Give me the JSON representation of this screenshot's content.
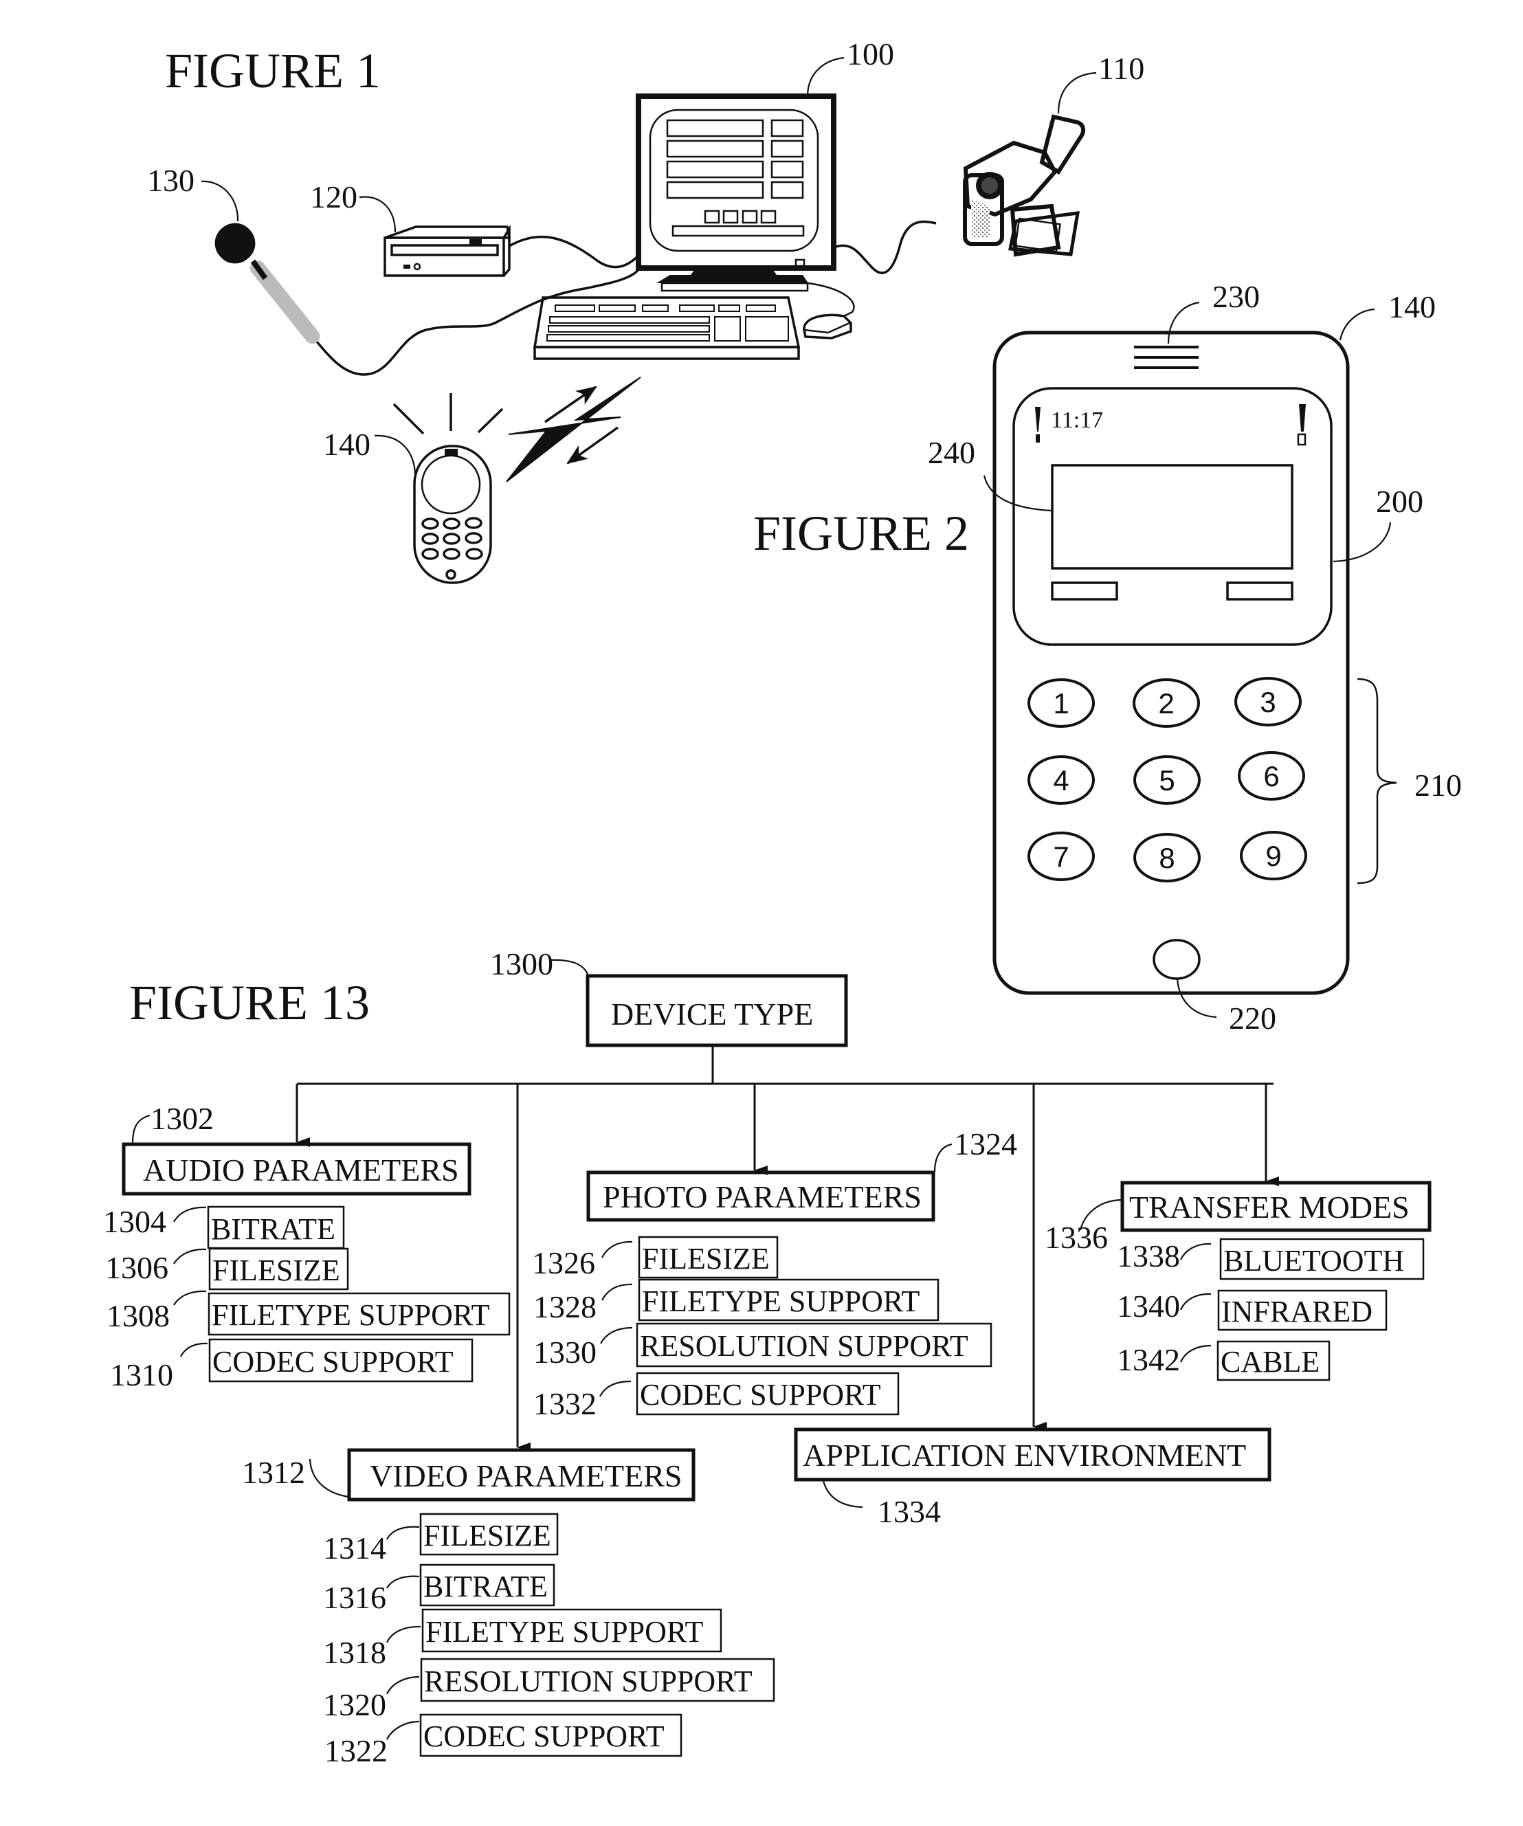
{
  "figures": {
    "fig1": {
      "title": "FIGURE 1",
      "refs": {
        "computer": "100",
        "camcorder": "110",
        "disc_drive": "120",
        "microphone": "130",
        "mobile_phone": "140"
      }
    },
    "fig2": {
      "title": "FIGURE 2",
      "refs": {
        "phone": "140",
        "display_area": "200",
        "keypad": "210",
        "home_button": "220",
        "speaker": "230",
        "screen": "240"
      },
      "status_text": "11:17",
      "keys": [
        "1",
        "2",
        "3",
        "4",
        "5",
        "6",
        "7",
        "8",
        "9"
      ]
    },
    "fig13": {
      "title": "FIGURE 13",
      "root": {
        "ref": "1300",
        "label": "DEVICE TYPE"
      },
      "audio": {
        "ref": "1302",
        "label": "AUDIO PARAMETERS",
        "items": [
          {
            "ref": "1304",
            "label": "BITRATE"
          },
          {
            "ref": "1306",
            "label": "FILESIZE"
          },
          {
            "ref": "1308",
            "label": "FILETYPE SUPPORT"
          },
          {
            "ref": "1310",
            "label": "CODEC SUPPORT"
          }
        ]
      },
      "video": {
        "ref": "1312",
        "label": "VIDEO PARAMETERS",
        "items": [
          {
            "ref": "1314",
            "label": "FILESIZE"
          },
          {
            "ref": "1316",
            "label": "BITRATE"
          },
          {
            "ref": "1318",
            "label": "FILETYPE SUPPORT"
          },
          {
            "ref": "1320",
            "label": "RESOLUTION SUPPORT"
          },
          {
            "ref": "1322",
            "label": "CODEC SUPPORT"
          }
        ]
      },
      "photo": {
        "ref": "1324",
        "label": "PHOTO PARAMETERS",
        "items": [
          {
            "ref": "1326",
            "label": "FILESIZE"
          },
          {
            "ref": "1328",
            "label": "FILETYPE SUPPORT"
          },
          {
            "ref": "1330",
            "label": "RESOLUTION SUPPORT"
          },
          {
            "ref": "1332",
            "label": "CODEC SUPPORT"
          }
        ]
      },
      "app_env": {
        "ref": "1334",
        "label": "APPLICATION ENVIRONMENT"
      },
      "transfer": {
        "ref": "1336",
        "label": "TRANSFER MODES",
        "items": [
          {
            "ref": "1338",
            "label": "BLUETOOTH"
          },
          {
            "ref": "1340",
            "label": "INFRARED"
          },
          {
            "ref": "1342",
            "label": "CABLE"
          }
        ]
      }
    }
  }
}
